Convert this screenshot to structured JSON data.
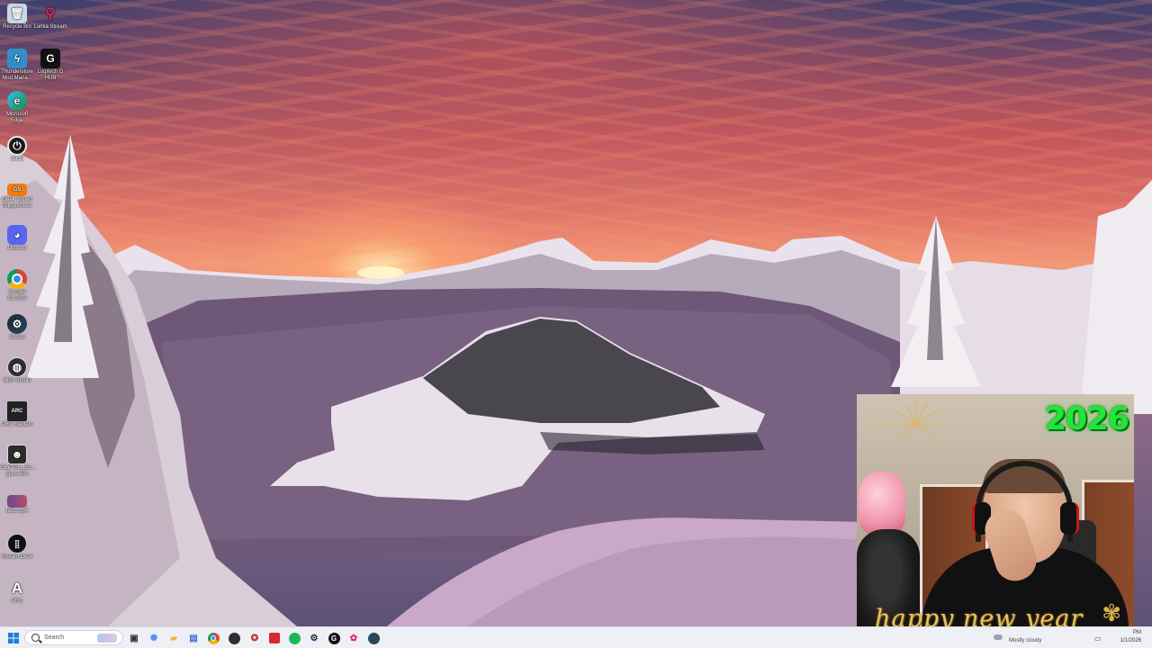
{
  "desktop_icons": [
    {
      "label": "Recycle Bin",
      "icon": "recycle-bin-icon",
      "color": "#9fb9d6"
    },
    {
      "label": "Lumia Stream",
      "icon": "lumia-stream-icon",
      "color": "#e0245e"
    },
    {
      "label": "Thunderstore Mod Mana...",
      "icon": "thunderstore-icon",
      "color": "#3a98d6"
    },
    {
      "label": "Logitech G HUB",
      "icon": "logitech-g-icon",
      "color": "#111111"
    },
    {
      "label": "Microsoft Edge",
      "icon": "edge-icon",
      "color": "#1fa1d9"
    },
    {
      "label": "iCUE",
      "icon": "icue-icon",
      "color": "#1a1a1a"
    },
    {
      "label": "Geek Squad Support.exe",
      "icon": "geek-squad-icon",
      "color": "#f07d10"
    },
    {
      "label": "Discord",
      "icon": "discord-icon",
      "color": "#5865f2"
    },
    {
      "label": "Google Chrome",
      "icon": "chrome-icon",
      "color": "#db4437"
    },
    {
      "label": "Steam",
      "icon": "steam-icon",
      "color": "#1b2838"
    },
    {
      "label": "OBS Studio",
      "icon": "obs-icon",
      "color": "#302e31"
    },
    {
      "label": "ARC Raiders",
      "icon": "arc-raiders-icon",
      "color": "#222222"
    },
    {
      "label": "GLYTCH_En... (1).webm",
      "icon": "video-file-icon",
      "color": "#2c2c2c"
    },
    {
      "label": "tatic.mp4",
      "icon": "video-file-icon",
      "color": "#6a4b8c"
    },
    {
      "label": "Stream Deck",
      "icon": "stream-deck-icon",
      "color": "#111111"
    },
    {
      "label": "ARC",
      "icon": "arc-browser-icon",
      "color": "#2a2a2a"
    }
  ],
  "webcam": {
    "year": "2026",
    "greeting": "happy new year"
  },
  "taskbar": {
    "search_placeholder": "Search",
    "apps": [
      {
        "name": "task-view-icon",
        "color": "#333333"
      },
      {
        "name": "copilot-icon",
        "color": "#5b8def"
      },
      {
        "name": "file-explorer-icon",
        "color": "#f2b632"
      },
      {
        "name": "microsoft-store-icon",
        "color": "#3a6fd8"
      },
      {
        "name": "chrome-icon",
        "color": "#db4437"
      },
      {
        "name": "obs-icon",
        "color": "#302e31"
      },
      {
        "name": "game-launcher-icon",
        "color": "#c0262d"
      },
      {
        "name": "adobe-icon",
        "color": "#d7262e"
      },
      {
        "name": "spotify-icon",
        "color": "#1db954"
      },
      {
        "name": "steam-icon",
        "color": "#1b2838"
      },
      {
        "name": "logitech-g-icon",
        "color": "#111111"
      },
      {
        "name": "lumia-stream-icon",
        "color": "#e0245e"
      },
      {
        "name": "steam-alt-icon",
        "color": "#2a475e"
      }
    ],
    "weather": "Mostly cloudy",
    "clock_time": "PM",
    "clock_date": "1/1/2026"
  }
}
